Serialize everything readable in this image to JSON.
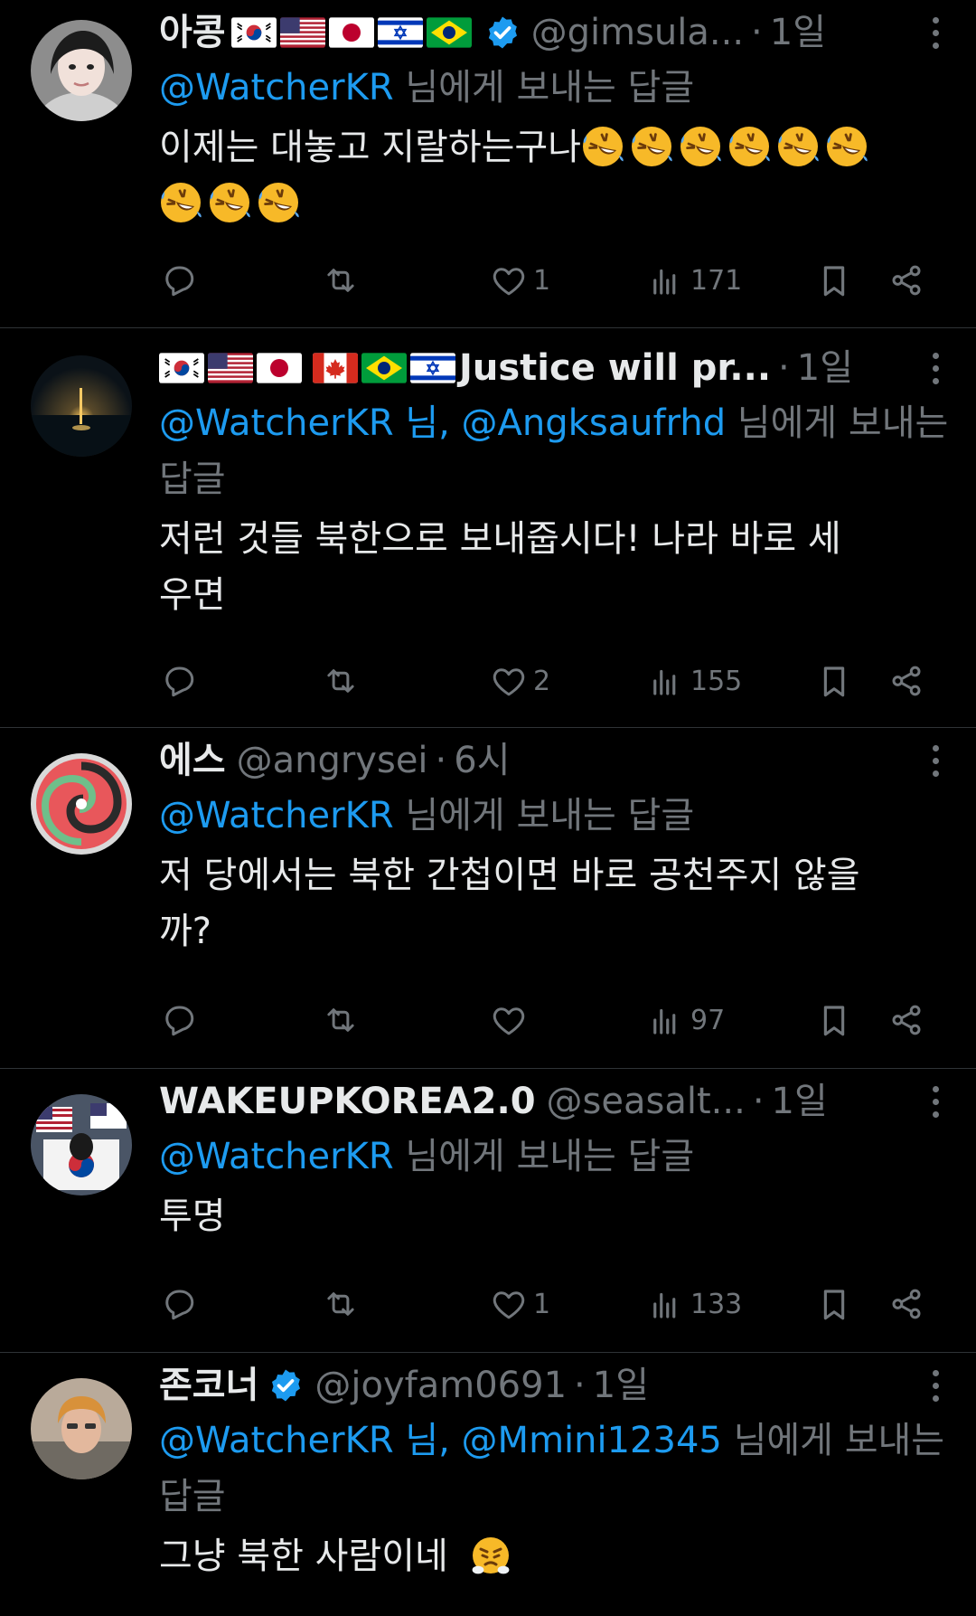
{
  "tweets": [
    {
      "name": "아콩",
      "flags": [
        "kr",
        "us",
        "jp",
        "il",
        "br"
      ],
      "verified": true,
      "handle": "@gimsula...",
      "separator": "·",
      "time": "1일",
      "reply_mention": "@WatcherKR",
      "reply_suffix": " 님에게 보내는 답글",
      "text": "이제는 대놓고 지랄하는구나",
      "emoji_count": 9,
      "likes": "1",
      "views": "171"
    },
    {
      "name": "Justice will pr...",
      "flags": [
        "kr",
        "us",
        "jp",
        "ca",
        "br",
        "il"
      ],
      "verified": false,
      "handle": "",
      "separator": "·",
      "time": "1일",
      "reply_mention": "@WatcherKR 님, @Angksaufrhd",
      "reply_suffix": " 님에게 보내는 답글",
      "text": "저런 것들 북한으로 보내줍시다! 나라 바로 세우면",
      "likes": "2",
      "views": "155"
    },
    {
      "name": "에스",
      "handle": "@angrysei",
      "separator": "·",
      "time": "6시",
      "reply_mention": "@WatcherKR",
      "reply_suffix": " 님에게 보내는 답글",
      "text": "저 당에서는 북한 간첩이면 바로 공천주지 않을까?",
      "likes": "",
      "views": "97"
    },
    {
      "name": "WAKEUPKOREA2.0",
      "handle": "@seasalt...",
      "separator": "·",
      "time": "1일",
      "reply_mention": "@WatcherKR",
      "reply_suffix": " 님에게 보내는 답글",
      "text": "투명",
      "likes": "1",
      "views": "133"
    },
    {
      "name": "존코너",
      "verified": true,
      "handle": "@joyfam0691",
      "separator": "·",
      "time": "1일",
      "reply_mention": "@WatcherKR 님, @Mmini12345",
      "reply_suffix": " 님에게 보내는 답글",
      "text": "그냥 북한 사람이네"
    }
  ],
  "colors": {
    "background": "#000000",
    "text": "#e7e9ea",
    "muted": "#71767b",
    "link": "#1d9bf0",
    "divider": "#2f3336"
  }
}
